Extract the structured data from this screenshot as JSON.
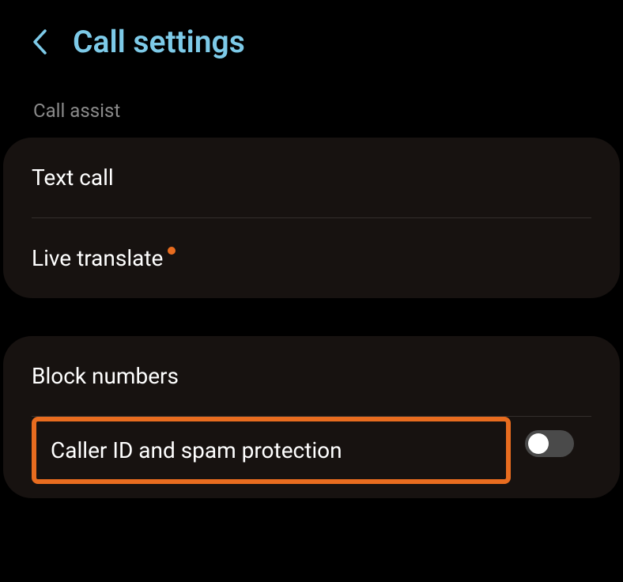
{
  "header": {
    "title": "Call settings"
  },
  "sections": {
    "call_assist": {
      "label": "Call assist",
      "items": {
        "text_call": "Text call",
        "live_translate": "Live translate"
      }
    },
    "blocking": {
      "items": {
        "block_numbers": "Block numbers",
        "caller_id_spam": "Caller ID and spam protection"
      },
      "caller_id_toggle_state": "off"
    }
  },
  "colors": {
    "accent": "#7dcae8",
    "highlight": "#e86c1f",
    "card_bg": "#171210",
    "background": "#000000"
  }
}
